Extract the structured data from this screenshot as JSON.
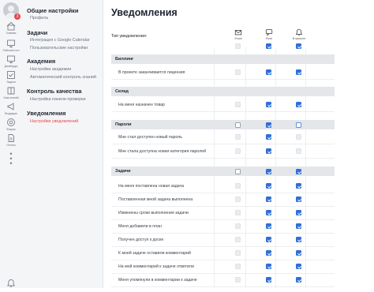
{
  "rail": {
    "badge": "3",
    "items": [
      {
        "icon": "home-icon",
        "label": "Главная"
      },
      {
        "icon": "monitor-icon",
        "label": "Рабочий стол"
      },
      {
        "icon": "monitor-icon",
        "label": "Дашборды"
      },
      {
        "icon": "checklist-icon",
        "label": "Задачи"
      },
      {
        "icon": "book-icon",
        "label": "База знаний"
      },
      {
        "icon": "megaphone-icon",
        "label": "Входящие"
      },
      {
        "icon": "target-icon",
        "label": "Фокусы"
      },
      {
        "icon": "document-icon",
        "label": "Отчеты"
      }
    ]
  },
  "nav": {
    "sections": [
      {
        "title": "Общие настройки",
        "items": [
          {
            "label": "Профиль",
            "active": false
          }
        ]
      },
      {
        "title": "Задачи",
        "items": [
          {
            "label": "Интеграция с Google Calendar",
            "active": false
          },
          {
            "label": "Пользовательские настройки",
            "active": false
          }
        ]
      },
      {
        "title": "Академия",
        "items": [
          {
            "label": "Настройки академии",
            "active": false
          },
          {
            "label": "Автоматический контроль знаний",
            "active": false
          }
        ]
      },
      {
        "title": "Контроль качества",
        "items": [
          {
            "label": "Настройка панели проверки",
            "active": false
          }
        ]
      },
      {
        "title": "Уведомления",
        "items": [
          {
            "label": "Настройки уведомлений",
            "active": true
          }
        ]
      }
    ]
  },
  "main": {
    "title": "Уведомления",
    "type_label": "Тип уведомления:",
    "columns": [
      {
        "icon": "mail-icon",
        "label": "Email"
      },
      {
        "icon": "chat-icon",
        "label": "Push"
      },
      {
        "icon": "bell-icon",
        "label": "В проекте"
      }
    ],
    "header_checks": [
      "off",
      "on",
      "on"
    ],
    "groups": [
      {
        "title": "Биллинг",
        "checks": null,
        "rows": [
          {
            "label": "В проекте заканчивается лицензия",
            "checks": [
              "off",
              "on",
              "on"
            ]
          }
        ]
      },
      {
        "title": "Склад",
        "checks": null,
        "rows": [
          {
            "label": "На меня назначен товар",
            "checks": [
              "off",
              "on",
              "on"
            ]
          }
        ]
      },
      {
        "title": "Пароли",
        "checks": [
          "outline",
          "on",
          "outline-blue"
        ],
        "rows": [
          {
            "label": "Мне стал доступен новый пароль",
            "checks": [
              "off",
              "on",
              "off"
            ]
          },
          {
            "label": "Мне стала доступна новая категория паролей",
            "checks": [
              "off",
              "on",
              "off"
            ]
          }
        ]
      },
      {
        "title": "Задачи",
        "checks": [
          "outline",
          "on",
          "on"
        ],
        "rows": [
          {
            "label": "На меня поставлена новая задача",
            "checks": [
              "off",
              "on",
              "on"
            ]
          },
          {
            "label": "Поставленная мной задача выполнена",
            "checks": [
              "off",
              "on",
              "on"
            ]
          },
          {
            "label": "Изменены сроки выполнения задачи",
            "checks": [
              "off",
              "on",
              "on"
            ]
          },
          {
            "label": "Меня добавили в план",
            "checks": [
              "off",
              "on",
              "on"
            ]
          },
          {
            "label": "Получен доступ к доске",
            "checks": [
              "off",
              "on",
              "on"
            ]
          },
          {
            "label": "К моей задаче оставили комментарий",
            "checks": [
              "off",
              "on",
              "on"
            ]
          },
          {
            "label": "На мой комментарий к задаче ответили",
            "checks": [
              "off",
              "on",
              "on"
            ]
          },
          {
            "label": "Меня упомянули в комментарии к задаче",
            "checks": [
              "off",
              "on",
              "on"
            ]
          }
        ]
      }
    ]
  }
}
